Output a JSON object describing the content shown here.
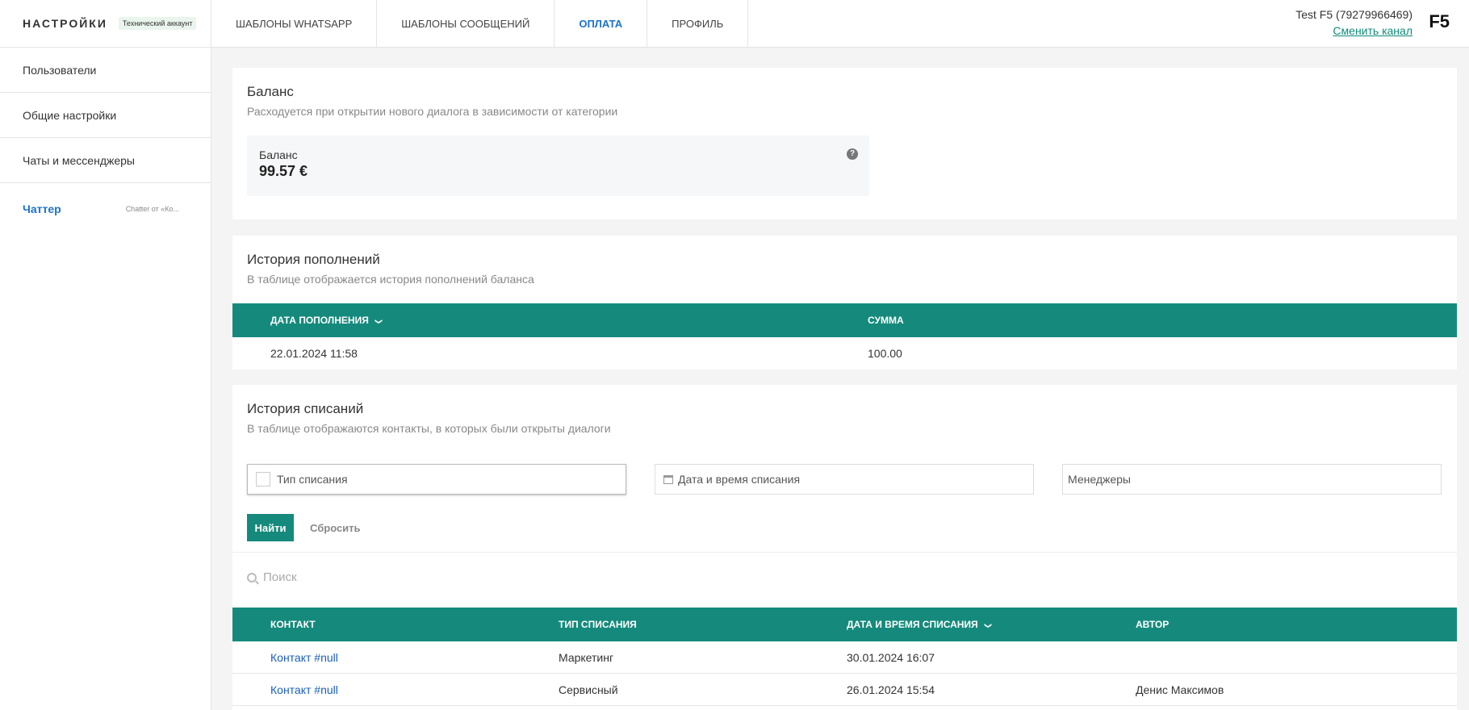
{
  "sidebar": {
    "title": "НАСТРОЙКИ",
    "badge": "Технический аккаунт",
    "items": [
      {
        "label": "Пользователи"
      },
      {
        "label": "Общие настройки"
      },
      {
        "label": "Чаты и мессенджеры"
      },
      {
        "label": "Чаттер",
        "sub": "Chatter от «Ко..."
      }
    ]
  },
  "nav": {
    "tabs": [
      "ШАБЛОНЫ WHATSAPP",
      "ШАБЛОНЫ СООБЩЕНИЙ",
      "ОПЛАТА",
      "ПРОФИЛЬ"
    ],
    "active_tab": "ОПЛАТА"
  },
  "user": {
    "name": "Test F5 (79279966469)",
    "change_channel": "Сменить канал",
    "logo": "F5"
  },
  "balance": {
    "title": "Баланс",
    "subtitle": "Расходуется при открытии нового диалога в зависимости от категории",
    "box_label": "Баланс",
    "value": "99.57 €"
  },
  "topups": {
    "title": "История пополнений",
    "subtitle": "В таблице отображается история пополнений баланса",
    "columns": [
      "ДАТА ПОПОЛНЕНИЯ",
      "СУММА"
    ],
    "rows": [
      {
        "date": "22.01.2024 11:58",
        "amount": "100.00"
      }
    ]
  },
  "charges": {
    "title": "История списаний",
    "subtitle": "В таблице отображаются контакты, в которых были открыты диалоги",
    "filters": {
      "type": "Тип списания",
      "datetime": "Дата и время списания",
      "managers": "Менеджеры"
    },
    "find_label": "Найти",
    "reset_label": "Сбросить",
    "search_placeholder": "Поиск",
    "columns": [
      "КОНТАКТ",
      "ТИП СПИСАНИЯ",
      "ДАТА И ВРЕМЯ СПИСАНИЯ",
      "АВТОР"
    ],
    "rows": [
      {
        "contact": "Контакт #null",
        "type": "Маркетинг",
        "datetime": "30.01.2024 16:07",
        "author": ""
      },
      {
        "contact": "Контакт #null",
        "type": "Сервисный",
        "datetime": "26.01.2024 15:54",
        "author": "Денис Максимов"
      }
    ]
  },
  "colors": {
    "accent": "#158a7c",
    "link": "#1a73c9"
  }
}
